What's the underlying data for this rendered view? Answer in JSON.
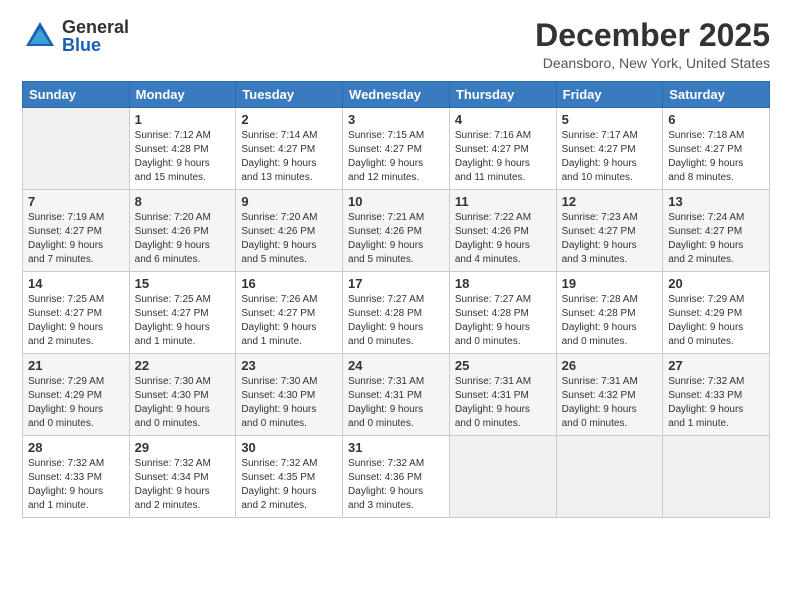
{
  "header": {
    "logo_general": "General",
    "logo_blue": "Blue",
    "month_title": "December 2025",
    "location": "Deansboro, New York, United States"
  },
  "days_of_week": [
    "Sunday",
    "Monday",
    "Tuesday",
    "Wednesday",
    "Thursday",
    "Friday",
    "Saturday"
  ],
  "weeks": [
    [
      {
        "day": "",
        "info": ""
      },
      {
        "day": "1",
        "info": "Sunrise: 7:12 AM\nSunset: 4:28 PM\nDaylight: 9 hours\nand 15 minutes."
      },
      {
        "day": "2",
        "info": "Sunrise: 7:14 AM\nSunset: 4:27 PM\nDaylight: 9 hours\nand 13 minutes."
      },
      {
        "day": "3",
        "info": "Sunrise: 7:15 AM\nSunset: 4:27 PM\nDaylight: 9 hours\nand 12 minutes."
      },
      {
        "day": "4",
        "info": "Sunrise: 7:16 AM\nSunset: 4:27 PM\nDaylight: 9 hours\nand 11 minutes."
      },
      {
        "day": "5",
        "info": "Sunrise: 7:17 AM\nSunset: 4:27 PM\nDaylight: 9 hours\nand 10 minutes."
      },
      {
        "day": "6",
        "info": "Sunrise: 7:18 AM\nSunset: 4:27 PM\nDaylight: 9 hours\nand 8 minutes."
      }
    ],
    [
      {
        "day": "7",
        "info": "Sunrise: 7:19 AM\nSunset: 4:27 PM\nDaylight: 9 hours\nand 7 minutes."
      },
      {
        "day": "8",
        "info": "Sunrise: 7:20 AM\nSunset: 4:26 PM\nDaylight: 9 hours\nand 6 minutes."
      },
      {
        "day": "9",
        "info": "Sunrise: 7:20 AM\nSunset: 4:26 PM\nDaylight: 9 hours\nand 5 minutes."
      },
      {
        "day": "10",
        "info": "Sunrise: 7:21 AM\nSunset: 4:26 PM\nDaylight: 9 hours\nand 5 minutes."
      },
      {
        "day": "11",
        "info": "Sunrise: 7:22 AM\nSunset: 4:26 PM\nDaylight: 9 hours\nand 4 minutes."
      },
      {
        "day": "12",
        "info": "Sunrise: 7:23 AM\nSunset: 4:27 PM\nDaylight: 9 hours\nand 3 minutes."
      },
      {
        "day": "13",
        "info": "Sunrise: 7:24 AM\nSunset: 4:27 PM\nDaylight: 9 hours\nand 2 minutes."
      }
    ],
    [
      {
        "day": "14",
        "info": "Sunrise: 7:25 AM\nSunset: 4:27 PM\nDaylight: 9 hours\nand 2 minutes."
      },
      {
        "day": "15",
        "info": "Sunrise: 7:25 AM\nSunset: 4:27 PM\nDaylight: 9 hours\nand 1 minute."
      },
      {
        "day": "16",
        "info": "Sunrise: 7:26 AM\nSunset: 4:27 PM\nDaylight: 9 hours\nand 1 minute."
      },
      {
        "day": "17",
        "info": "Sunrise: 7:27 AM\nSunset: 4:28 PM\nDaylight: 9 hours\nand 0 minutes."
      },
      {
        "day": "18",
        "info": "Sunrise: 7:27 AM\nSunset: 4:28 PM\nDaylight: 9 hours\nand 0 minutes."
      },
      {
        "day": "19",
        "info": "Sunrise: 7:28 AM\nSunset: 4:28 PM\nDaylight: 9 hours\nand 0 minutes."
      },
      {
        "day": "20",
        "info": "Sunrise: 7:29 AM\nSunset: 4:29 PM\nDaylight: 9 hours\nand 0 minutes."
      }
    ],
    [
      {
        "day": "21",
        "info": "Sunrise: 7:29 AM\nSunset: 4:29 PM\nDaylight: 9 hours\nand 0 minutes."
      },
      {
        "day": "22",
        "info": "Sunrise: 7:30 AM\nSunset: 4:30 PM\nDaylight: 9 hours\nand 0 minutes."
      },
      {
        "day": "23",
        "info": "Sunrise: 7:30 AM\nSunset: 4:30 PM\nDaylight: 9 hours\nand 0 minutes."
      },
      {
        "day": "24",
        "info": "Sunrise: 7:31 AM\nSunset: 4:31 PM\nDaylight: 9 hours\nand 0 minutes."
      },
      {
        "day": "25",
        "info": "Sunrise: 7:31 AM\nSunset: 4:31 PM\nDaylight: 9 hours\nand 0 minutes."
      },
      {
        "day": "26",
        "info": "Sunrise: 7:31 AM\nSunset: 4:32 PM\nDaylight: 9 hours\nand 0 minutes."
      },
      {
        "day": "27",
        "info": "Sunrise: 7:32 AM\nSunset: 4:33 PM\nDaylight: 9 hours\nand 1 minute."
      }
    ],
    [
      {
        "day": "28",
        "info": "Sunrise: 7:32 AM\nSunset: 4:33 PM\nDaylight: 9 hours\nand 1 minute."
      },
      {
        "day": "29",
        "info": "Sunrise: 7:32 AM\nSunset: 4:34 PM\nDaylight: 9 hours\nand 2 minutes."
      },
      {
        "day": "30",
        "info": "Sunrise: 7:32 AM\nSunset: 4:35 PM\nDaylight: 9 hours\nand 2 minutes."
      },
      {
        "day": "31",
        "info": "Sunrise: 7:32 AM\nSunset: 4:36 PM\nDaylight: 9 hours\nand 3 minutes."
      },
      {
        "day": "",
        "info": ""
      },
      {
        "day": "",
        "info": ""
      },
      {
        "day": "",
        "info": ""
      }
    ]
  ]
}
